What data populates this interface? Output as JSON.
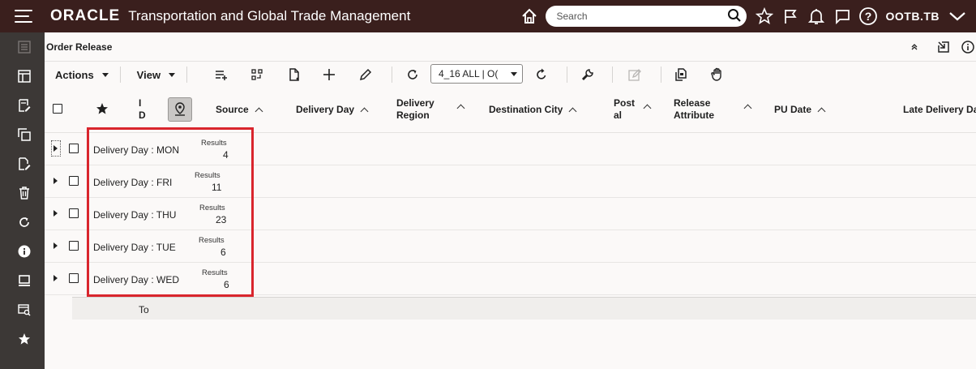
{
  "header": {
    "brand": "ORACLE",
    "app_title": "Transportation and Global Trade Management",
    "search_placeholder": "Search",
    "user": "OOTB.TB"
  },
  "page": {
    "title": "Order Release"
  },
  "toolbar": {
    "actions_label": "Actions",
    "view_label": "View",
    "saved_query_value": "4_16 ALL | O("
  },
  "columns": {
    "id_line1": "I",
    "id_line2": "D",
    "source": "Source",
    "delivery_day": "Delivery Day",
    "delivery_region_1": "Delivery",
    "delivery_region_2": "Region",
    "destination_city": "Destination City",
    "postal_1": "Post",
    "postal_2": "al",
    "release_attr_1": "Release",
    "release_attr_2": "Attribute",
    "pu_date": "PU Date",
    "late_delivery": "Late Delivery Da"
  },
  "groups": [
    {
      "label": "Delivery Day : MON",
      "results_label": "Results",
      "count": "4"
    },
    {
      "label": "Delivery Day : FRI",
      "results_label": "Results",
      "count": "11"
    },
    {
      "label": "Delivery Day : THU",
      "results_label": "Results",
      "count": "23"
    },
    {
      "label": "Delivery Day : TUE",
      "results_label": "Results",
      "count": "6"
    },
    {
      "label": "Delivery Day : WED",
      "results_label": "Results",
      "count": "6"
    }
  ],
  "total_label": "To",
  "colors": {
    "header_bg": "#3a1f1d",
    "rail_bg": "#3c3836",
    "highlight": "#d9252d"
  }
}
